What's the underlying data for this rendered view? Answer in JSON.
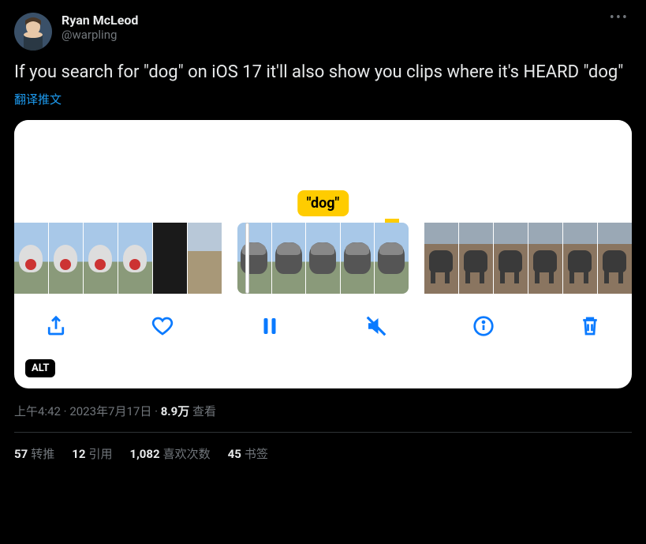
{
  "author": {
    "display_name": "Ryan McLeod",
    "handle": "@warpling"
  },
  "tweet_text": "If you search for \"dog\" on iOS 17 it'll also show you clips where it's HEARD \"dog\"",
  "translate_label": "翻译推文",
  "media": {
    "badge_text": "\"dog\"",
    "alt_label": "ALT"
  },
  "timestamp": {
    "time": "上午4:42",
    "date": "2023年7月17日",
    "views_number": "8.9万",
    "views_label": "查看"
  },
  "stats": {
    "retweets_count": "57",
    "retweets_label": "转推",
    "quotes_count": "12",
    "quotes_label": "引用",
    "likes_count": "1,082",
    "likes_label": "喜欢次数",
    "bookmarks_count": "45",
    "bookmarks_label": "书签"
  },
  "more_label": "•••"
}
